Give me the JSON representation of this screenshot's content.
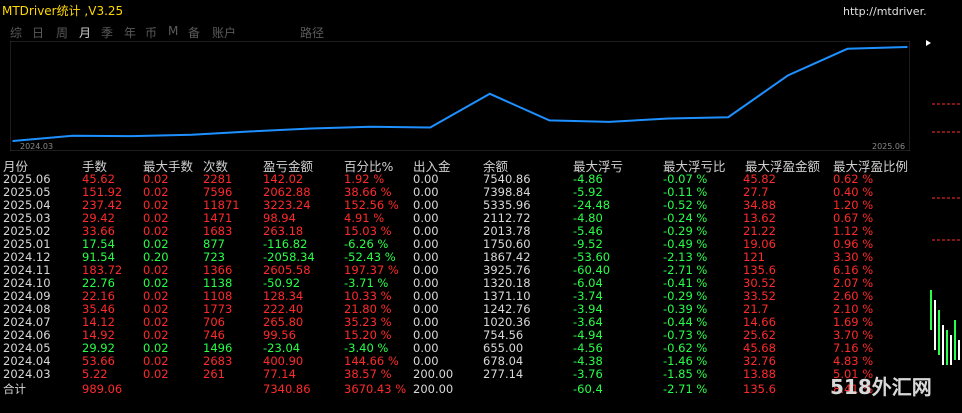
{
  "title": "MTDriver统计 ,V3.25",
  "url": "http://mtdriver.cn",
  "tabs": [
    "综",
    "日",
    "周",
    "月",
    "季",
    "年",
    "币",
    "M",
    "备",
    "账户",
    "路径"
  ],
  "active_tab": "月",
  "chart_data": {
    "type": "line",
    "x": [
      "2024.03",
      "2024.04",
      "2024.05",
      "2024.06",
      "2024.07",
      "2024.08",
      "2024.09",
      "2024.10",
      "2024.11",
      "2024.12",
      "2025.01",
      "2025.02",
      "2025.03",
      "2025.04",
      "2025.05",
      "2025.06"
    ],
    "series": [
      {
        "values": [
          277.14,
          678.04,
          655.0,
          754.56,
          1020.36,
          1242.76,
          1371.1,
          1320.18,
          3925.76,
          1867.42,
          1750.6,
          2013.78,
          2112.72,
          5335.96,
          7398.84,
          7540.86
        ]
      }
    ],
    "x_start_label": "2024.03",
    "x_end_label": "2025.06",
    "grid": false,
    "line_color": "#1e90ff"
  },
  "table": {
    "headers": [
      "月份",
      "手数",
      "最大手数",
      "次数",
      "盈亏金额",
      "百分比%",
      "出入金",
      "余额",
      "最大浮亏",
      "最大浮亏比",
      "最大浮盈金额",
      "最大浮盈比例"
    ],
    "rows": [
      [
        "2025.06",
        "45.62",
        "0.02",
        "2281",
        "142.02",
        "1.92 %",
        "0.00",
        "7540.86",
        "-4.86",
        "-0.07 %",
        "45.82",
        "0.62 %"
      ],
      [
        "2025.05",
        "151.92",
        "0.02",
        "7596",
        "2062.88",
        "38.66 %",
        "0.00",
        "7398.84",
        "-5.92",
        "-0.11 %",
        "27.7",
        "0.40 %"
      ],
      [
        "2025.04",
        "237.42",
        "0.02",
        "11871",
        "3223.24",
        "152.56 %",
        "0.00",
        "5335.96",
        "-24.48",
        "-0.52 %",
        "34.88",
        "1.20 %"
      ],
      [
        "2025.03",
        "29.42",
        "0.02",
        "1471",
        "98.94",
        "4.91 %",
        "0.00",
        "2112.72",
        "-4.80",
        "-0.24 %",
        "13.62",
        "0.67 %"
      ],
      [
        "2025.02",
        "33.66",
        "0.02",
        "1683",
        "263.18",
        "15.03 %",
        "0.00",
        "2013.78",
        "-5.46",
        "-0.29 %",
        "21.22",
        "1.12 %"
      ],
      [
        "2025.01",
        "17.54",
        "0.02",
        "877",
        "-116.82",
        "-6.26 %",
        "0.00",
        "1750.60",
        "-9.52",
        "-0.49 %",
        "19.06",
        "0.96 %"
      ],
      [
        "2024.12",
        "91.54",
        "0.20",
        "723",
        "-2058.34",
        "-52.43 %",
        "0.00",
        "1867.42",
        "-53.60",
        "-2.13 %",
        "121",
        "3.30 %"
      ],
      [
        "2024.11",
        "183.72",
        "0.02",
        "1366",
        "2605.58",
        "197.37 %",
        "0.00",
        "3925.76",
        "-60.40",
        "-2.71 %",
        "135.6",
        "6.16 %"
      ],
      [
        "2024.10",
        "22.76",
        "0.02",
        "1138",
        "-50.92",
        "-3.71 %",
        "0.00",
        "1320.18",
        "-6.04",
        "-0.41 %",
        "30.52",
        "2.07 %"
      ],
      [
        "2024.09",
        "22.16",
        "0.02",
        "1108",
        "128.34",
        "10.33 %",
        "0.00",
        "1371.10",
        "-3.74",
        "-0.29 %",
        "33.52",
        "2.60 %"
      ],
      [
        "2024.08",
        "35.46",
        "0.02",
        "1773",
        "222.40",
        "21.80 %",
        "0.00",
        "1242.76",
        "-3.94",
        "-0.39 %",
        "21.7",
        "2.10 %"
      ],
      [
        "2024.07",
        "14.12",
        "0.02",
        "706",
        "265.80",
        "35.23 %",
        "0.00",
        "1020.36",
        "-3.64",
        "-0.44 %",
        "14.66",
        "1.69 %"
      ],
      [
        "2024.06",
        "14.92",
        "0.02",
        "746",
        "99.56",
        "15.20 %",
        "0.00",
        "754.56",
        "-4.94",
        "-0.73 %",
        "25.62",
        "3.70 %"
      ],
      [
        "2024.05",
        "29.92",
        "0.02",
        "1496",
        "-23.04",
        "-3.40 %",
        "0.00",
        "655.00",
        "-4.56",
        "-0.62 %",
        "45.68",
        "7.16 %"
      ],
      [
        "2024.04",
        "53.66",
        "0.02",
        "2683",
        "400.90",
        "144.66 %",
        "0.00",
        "678.04",
        "-4.38",
        "-1.46 %",
        "32.76",
        "4.83 %"
      ],
      [
        "2024.03",
        "5.22",
        "0.02",
        "261",
        "77.14",
        "38.57 %",
        "200.00",
        "277.14",
        "-3.76",
        "-1.85 %",
        "13.88",
        "5.01 %"
      ]
    ],
    "total": [
      "合计",
      "989.06",
      "",
      "",
      "7340.86",
      "3670.43 %",
      "200.00",
      "",
      "-60.4",
      "-2.71 %",
      "135.6",
      "8.41 %"
    ]
  },
  "watermark": "518外汇网",
  "colors": {
    "positive": "#ff2a2a",
    "negative": "#28ff48",
    "title": "#ffd700",
    "line": "#1e90ff"
  }
}
